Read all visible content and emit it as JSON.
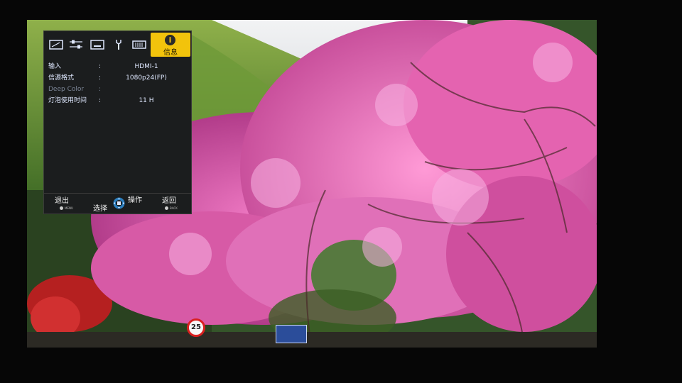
{
  "osd": {
    "tabs": [
      {
        "icon": "picture-icon"
      },
      {
        "icon": "adjust-sliders-icon"
      },
      {
        "icon": "input-settings-icon"
      },
      {
        "icon": "wrench-icon"
      },
      {
        "icon": "display-icon"
      },
      {
        "icon": "info-icon",
        "label": "信息",
        "active": true
      }
    ],
    "accent_color": "#f2c30c",
    "info_rows": [
      {
        "label": "输入",
        "value": "HDMI-1",
        "dim": false
      },
      {
        "label": "信源格式",
        "value": "1080p24(FP)",
        "dim": false
      },
      {
        "label": "Deep Color",
        "value": "",
        "dim": true
      },
      {
        "label": "灯泡使用时间",
        "value": "11 H",
        "dim": false
      }
    ],
    "separator": ":",
    "footer": {
      "exit_label": "退出",
      "exit_key": "MENU",
      "select_label": "选择",
      "operate_label": "操作",
      "back_label": "返回",
      "back_key": "BACK"
    }
  },
  "scene": {
    "speed_sign": "25"
  }
}
